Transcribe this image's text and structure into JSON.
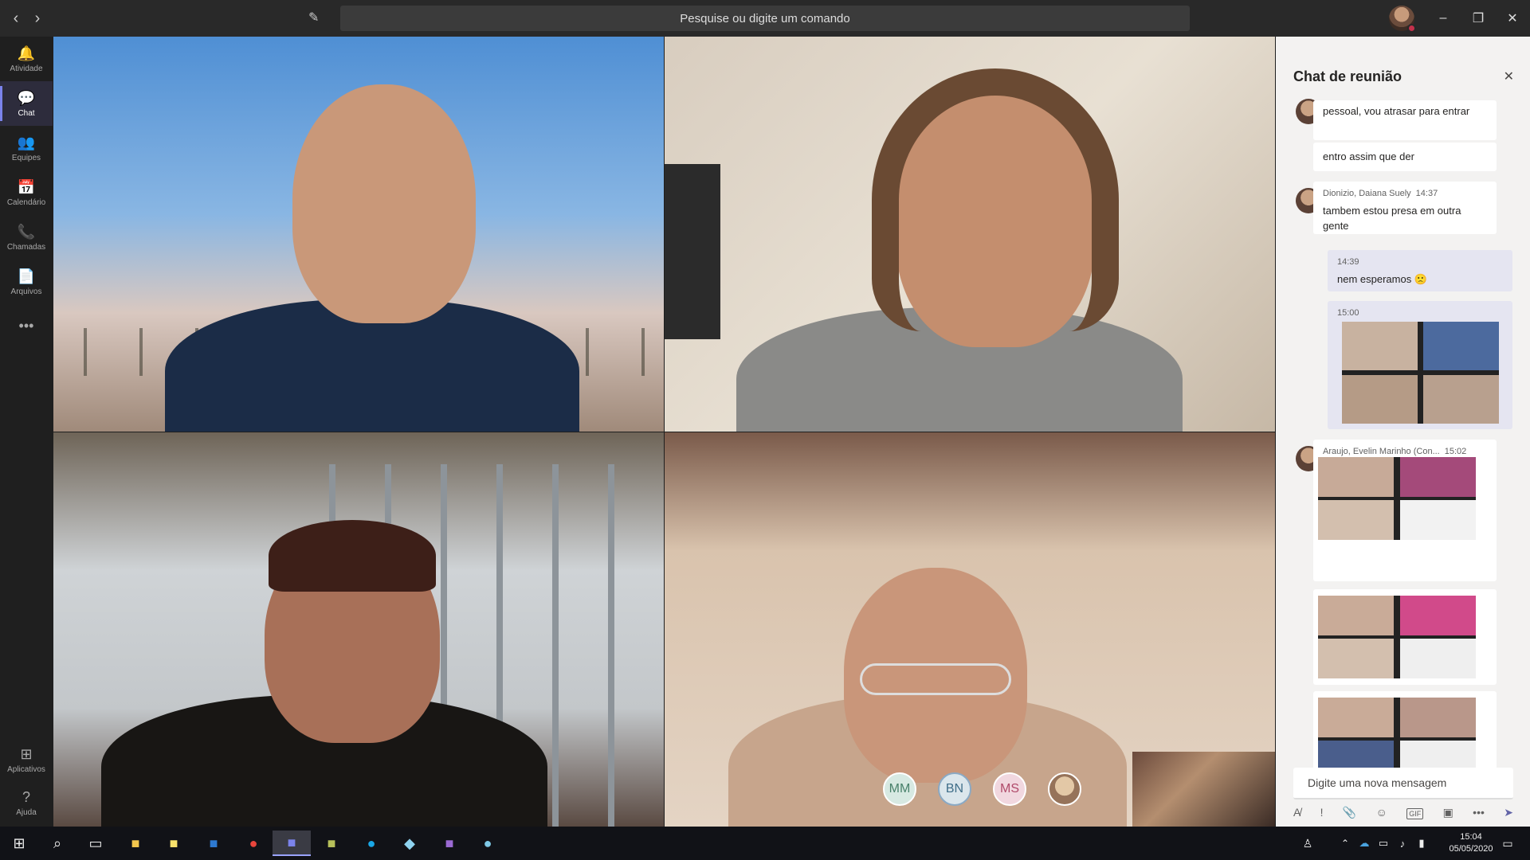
{
  "titlebar": {
    "back": "‹",
    "forward": "›",
    "compose": "✎",
    "search_placeholder": "Pesquise ou digite um comando",
    "minimize": "–",
    "restore": "❐",
    "close": "✕"
  },
  "rail": {
    "items": [
      {
        "label": "Atividade",
        "icon": "🔔"
      },
      {
        "label": "Chat",
        "icon": "💬"
      },
      {
        "label": "Equipes",
        "icon": "👥"
      },
      {
        "label": "Calendário",
        "icon": "📅"
      },
      {
        "label": "Chamadas",
        "icon": "📞"
      },
      {
        "label": "Arquivos",
        "icon": "📄"
      },
      {
        "label": "",
        "icon": "•••"
      },
      {
        "label": "Aplicativos",
        "icon": "⊞"
      },
      {
        "label": "Ajuda",
        "icon": "?"
      }
    ]
  },
  "participants": {
    "initials": [
      "MM",
      "BN",
      "MS"
    ]
  },
  "chat": {
    "title": "Chat de reunião",
    "close": "✕",
    "messages": [
      {
        "text": "pessoal, vou atrasar para entrar"
      },
      {
        "text": "entro assim que der"
      },
      {
        "author": "Dionizio, Daiana Suely",
        "time": "14:37",
        "text": "tambem estou presa em outra gente"
      },
      {
        "time": "14:39",
        "text": "nem esperamos 🙁"
      },
      {
        "time": "15:00"
      },
      {
        "author": "Araujo, Evelin Marinho (Con...",
        "time": "15:02"
      }
    ],
    "input_placeholder": "Digite uma nova mensagem",
    "toolbar": [
      "A̸",
      "!",
      "📎",
      "☺",
      "GIF",
      "▣",
      "•••",
      "➤"
    ]
  },
  "taskbar": {
    "time": "15:04",
    "date": "05/05/2020"
  },
  "colors": {
    "accent": "#6264a7",
    "presence_busy": "#c4314b"
  }
}
